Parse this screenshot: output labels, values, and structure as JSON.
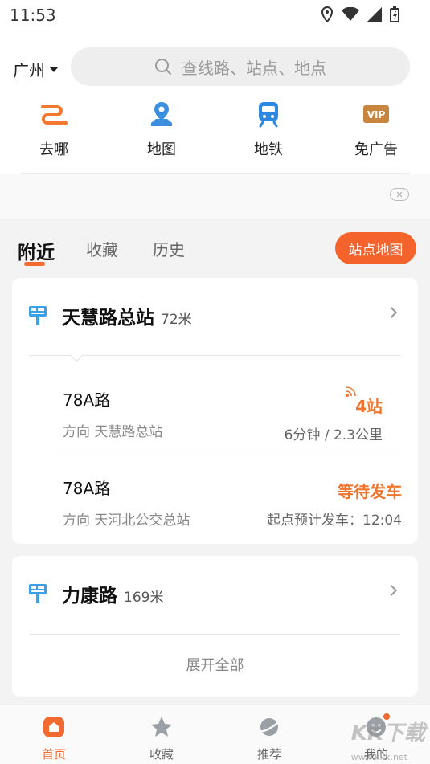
{
  "status_bar": {
    "time": "11:53"
  },
  "header": {
    "city": "广州",
    "search_placeholder": "查线路、站点、地点",
    "quick_actions": [
      {
        "label": "去哪",
        "icon": "route-icon"
      },
      {
        "label": "地图",
        "icon": "map-pin-icon"
      },
      {
        "label": "地铁",
        "icon": "metro-icon"
      },
      {
        "label": "免广告",
        "icon": "vip-icon"
      }
    ]
  },
  "tabs": {
    "active": "附近",
    "second": "收藏",
    "third": "历史",
    "map_button": "站点地图"
  },
  "stops": [
    {
      "name": "天慧路总站",
      "distance": "72米",
      "routes": [
        {
          "name": "78A路",
          "direction": "方向 天慧路总站",
          "arrival": "4站",
          "detail": "6分钟 / 2.3公里"
        },
        {
          "name": "78A路",
          "direction": "方向 天河北公交总站",
          "arrival": "等待发车",
          "detail": "起点预计发车：12:04"
        }
      ]
    },
    {
      "name": "力康路",
      "distance": "169米",
      "expand_label": "展开全部"
    }
  ],
  "bottom_nav": [
    {
      "label": "首页",
      "icon": "home-icon"
    },
    {
      "label": "收藏",
      "icon": "star-icon"
    },
    {
      "label": "推荐",
      "icon": "planet-icon"
    },
    {
      "label": "我的",
      "icon": "profile-icon"
    }
  ],
  "watermark": {
    "main": "KK下载",
    "sub": "www.kkx.net"
  },
  "colors": {
    "accent": "#f26a2f",
    "arrival": "#f0762f",
    "stop_icon": "#3aa0e8"
  }
}
